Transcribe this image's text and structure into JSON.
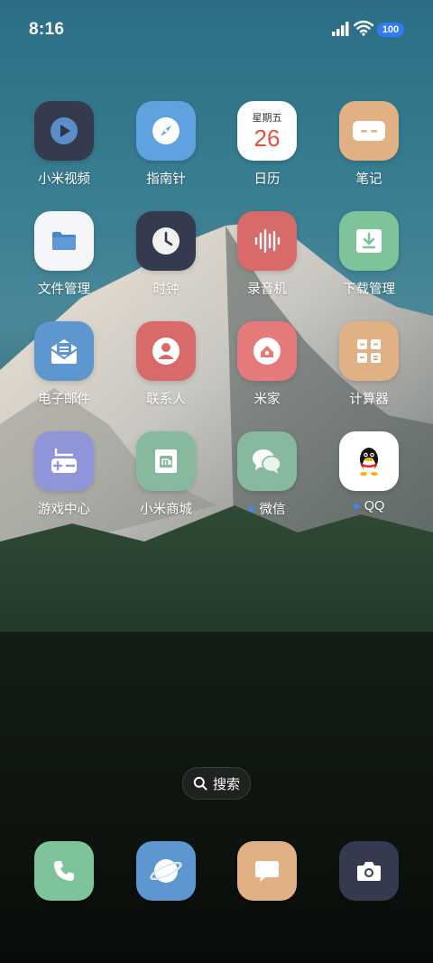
{
  "status": {
    "time": "8:16",
    "battery": "100"
  },
  "apps": [
    {
      "label": "小米视频",
      "color": "#353a4e",
      "icon": "play-icon"
    },
    {
      "label": "指南针",
      "color": "#5fa2e0",
      "icon": "compass-icon"
    },
    {
      "label": "日历",
      "color": "#ffffff",
      "icon": "calendar-icon",
      "weekday": "星期五",
      "day": "26"
    },
    {
      "label": "笔记",
      "color": "#e0b185",
      "icon": "note-icon"
    },
    {
      "label": "文件管理",
      "color": "#f4f6f9",
      "icon": "folder-icon"
    },
    {
      "label": "时钟",
      "color": "#353a4e",
      "icon": "clock-icon"
    },
    {
      "label": "录音机",
      "color": "#d96a6a",
      "icon": "waveform-icon"
    },
    {
      "label": "下载管理",
      "color": "#7ec39a",
      "icon": "download-icon"
    },
    {
      "label": "电子邮件",
      "color": "#5e97cf",
      "icon": "mail-icon"
    },
    {
      "label": "联系人",
      "color": "#d96a6a",
      "icon": "person-icon"
    },
    {
      "label": "米家",
      "color": "#e47a7a",
      "icon": "home-icon"
    },
    {
      "label": "计算器",
      "color": "#e0b185",
      "icon": "calculator-icon"
    },
    {
      "label": "游戏中心",
      "color": "#8f95d8",
      "icon": "gamepad-icon"
    },
    {
      "label": "小米商城",
      "color": "#86b99d",
      "icon": "store-icon"
    },
    {
      "label": "微信",
      "color": "#86b99d",
      "icon": "wechat-icon"
    },
    {
      "label": "QQ",
      "color": "#ffffff",
      "icon": "qq-icon"
    }
  ],
  "search": {
    "label": "搜索"
  },
  "dock": [
    {
      "name": "phone",
      "color": "#7ec39a",
      "icon": "phone-icon"
    },
    {
      "name": "browser",
      "color": "#5e97cf",
      "icon": "browser-icon"
    },
    {
      "name": "messages",
      "color": "#e0b185",
      "icon": "message-icon"
    },
    {
      "name": "camera",
      "color": "#353a4e",
      "icon": "camera-icon"
    }
  ]
}
